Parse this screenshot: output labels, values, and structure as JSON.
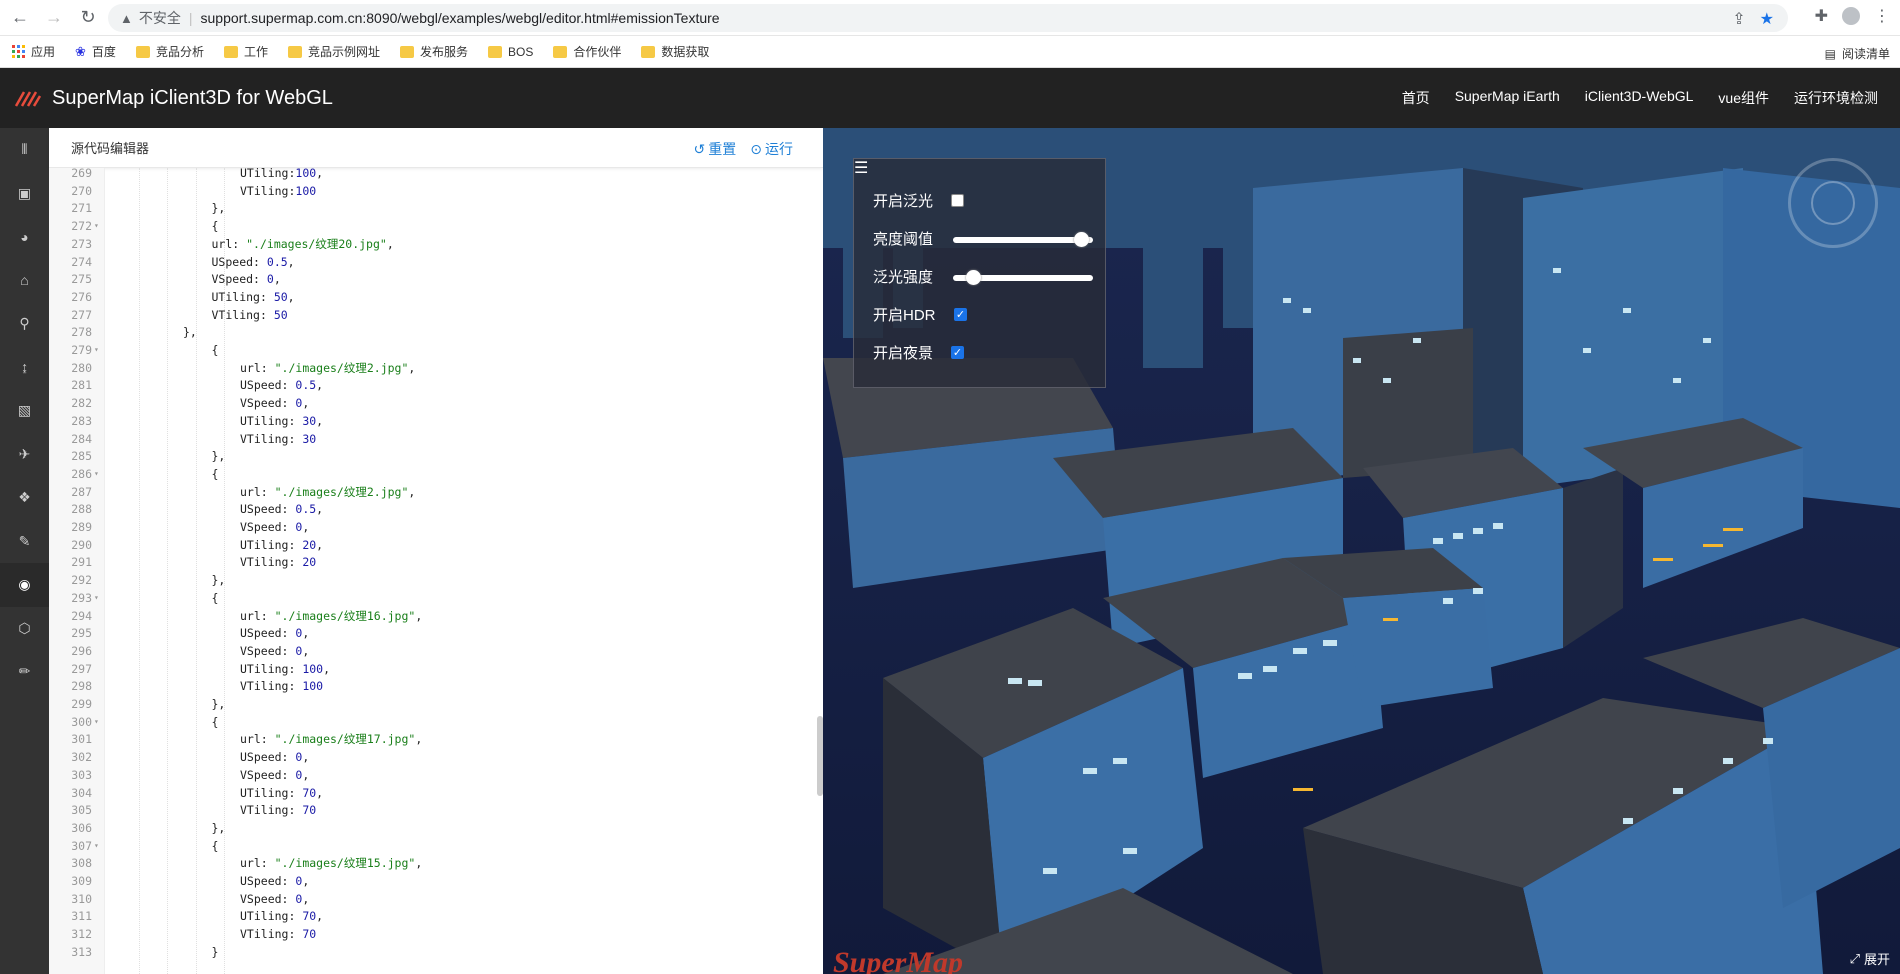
{
  "browser": {
    "insecure_label": "不安全",
    "url": "support.supermap.com.cn:8090/webgl/examples/webgl/editor.html#emissionTexture"
  },
  "bookmarks": [
    {
      "label": "应用",
      "type": "apps"
    },
    {
      "label": "百度",
      "type": "baidu"
    },
    {
      "label": "竞品分析",
      "type": "folder"
    },
    {
      "label": "工作",
      "type": "folder"
    },
    {
      "label": "竞品示例网址",
      "type": "folder"
    },
    {
      "label": "发布服务",
      "type": "folder"
    },
    {
      "label": "BOS",
      "type": "folder"
    },
    {
      "label": "合作伙伴",
      "type": "folder"
    },
    {
      "label": "数据获取",
      "type": "folder"
    }
  ],
  "reading_list": "阅读清单",
  "app": {
    "title": "SuperMap iClient3D for WebGL",
    "nav": [
      "首页",
      "SuperMap iEarth",
      "iClient3D-WebGL",
      "vue组件",
      "运行环境检测"
    ]
  },
  "editor": {
    "title": "源代码编辑器",
    "reset": "重置",
    "run": "运行",
    "lines": [
      {
        "n": "269",
        "f": "",
        "i": 4,
        "t": "UTiling:100,"
      },
      {
        "n": "270",
        "f": "",
        "i": 4,
        "t": "VTiling:100"
      },
      {
        "n": "271",
        "f": "",
        "i": 3,
        "t": "},"
      },
      {
        "n": "272",
        "f": "▾",
        "i": 3,
        "t": "{"
      },
      {
        "n": "273",
        "f": "",
        "i": 3,
        "t": "url: \"./images/纹理20.jpg\","
      },
      {
        "n": "274",
        "f": "",
        "i": 3,
        "t": "USpeed: 0.5,"
      },
      {
        "n": "275",
        "f": "",
        "i": 3,
        "t": "VSpeed: 0,"
      },
      {
        "n": "276",
        "f": "",
        "i": 3,
        "t": "UTiling: 50,"
      },
      {
        "n": "277",
        "f": "",
        "i": 3,
        "t": "VTiling: 50"
      },
      {
        "n": "278",
        "f": "",
        "i": 2,
        "t": "},"
      },
      {
        "n": "279",
        "f": "▾",
        "i": 3,
        "t": "{"
      },
      {
        "n": "280",
        "f": "",
        "i": 4,
        "t": "url: \"./images/纹理2.jpg\","
      },
      {
        "n": "281",
        "f": "",
        "i": 4,
        "t": "USpeed: 0.5,"
      },
      {
        "n": "282",
        "f": "",
        "i": 4,
        "t": "VSpeed: 0,"
      },
      {
        "n": "283",
        "f": "",
        "i": 4,
        "t": "UTiling: 30,"
      },
      {
        "n": "284",
        "f": "",
        "i": 4,
        "t": "VTiling: 30"
      },
      {
        "n": "285",
        "f": "",
        "i": 3,
        "t": "},"
      },
      {
        "n": "286",
        "f": "▾",
        "i": 3,
        "t": "{"
      },
      {
        "n": "287",
        "f": "",
        "i": 4,
        "t": "url: \"./images/纹理2.jpg\","
      },
      {
        "n": "288",
        "f": "",
        "i": 4,
        "t": "USpeed: 0.5,"
      },
      {
        "n": "289",
        "f": "",
        "i": 4,
        "t": "VSpeed: 0,"
      },
      {
        "n": "290",
        "f": "",
        "i": 4,
        "t": "UTiling: 20,"
      },
      {
        "n": "291",
        "f": "",
        "i": 4,
        "t": "VTiling: 20"
      },
      {
        "n": "292",
        "f": "",
        "i": 3,
        "t": "},"
      },
      {
        "n": "293",
        "f": "▾",
        "i": 3,
        "t": "{"
      },
      {
        "n": "294",
        "f": "",
        "i": 4,
        "t": "url: \"./images/纹理16.jpg\","
      },
      {
        "n": "295",
        "f": "",
        "i": 4,
        "t": "USpeed: 0,"
      },
      {
        "n": "296",
        "f": "",
        "i": 4,
        "t": "VSpeed: 0,"
      },
      {
        "n": "297",
        "f": "",
        "i": 4,
        "t": "UTiling: 100,"
      },
      {
        "n": "298",
        "f": "",
        "i": 4,
        "t": "VTiling: 100"
      },
      {
        "n": "299",
        "f": "",
        "i": 3,
        "t": "},"
      },
      {
        "n": "300",
        "f": "▾",
        "i": 3,
        "t": "{"
      },
      {
        "n": "301",
        "f": "",
        "i": 4,
        "t": "url: \"./images/纹理17.jpg\","
      },
      {
        "n": "302",
        "f": "",
        "i": 4,
        "t": "USpeed: 0,"
      },
      {
        "n": "303",
        "f": "",
        "i": 4,
        "t": "VSpeed: 0,"
      },
      {
        "n": "304",
        "f": "",
        "i": 4,
        "t": "UTiling: 70,"
      },
      {
        "n": "305",
        "f": "",
        "i": 4,
        "t": "VTiling: 70"
      },
      {
        "n": "306",
        "f": "",
        "i": 3,
        "t": "},"
      },
      {
        "n": "307",
        "f": "▾",
        "i": 3,
        "t": "{"
      },
      {
        "n": "308",
        "f": "",
        "i": 4,
        "t": "url: \"./images/纹理15.jpg\","
      },
      {
        "n": "309",
        "f": "",
        "i": 4,
        "t": "USpeed: 0,"
      },
      {
        "n": "310",
        "f": "",
        "i": 4,
        "t": "VSpeed: 0,"
      },
      {
        "n": "311",
        "f": "",
        "i": 4,
        "t": "UTiling: 70,"
      },
      {
        "n": "312",
        "f": "",
        "i": 4,
        "t": "VTiling: 70"
      },
      {
        "n": "313",
        "f": "",
        "i": 3,
        "t": "}"
      }
    ]
  },
  "controls": {
    "bloom_label": "开启泛光",
    "bloom_checked": false,
    "brightness_label": "亮度阈值",
    "brightness_value": 0.97,
    "bloom_strength_label": "泛光强度",
    "bloom_strength_value": 0.1,
    "hdr_label": "开启HDR",
    "hdr_checked": true,
    "night_label": "开启夜景",
    "night_checked": true
  },
  "expand_label": "展开",
  "colors": {
    "header_bg": "#222222",
    "sidebar_bg": "#333333",
    "accent": "#1e7fd6"
  }
}
